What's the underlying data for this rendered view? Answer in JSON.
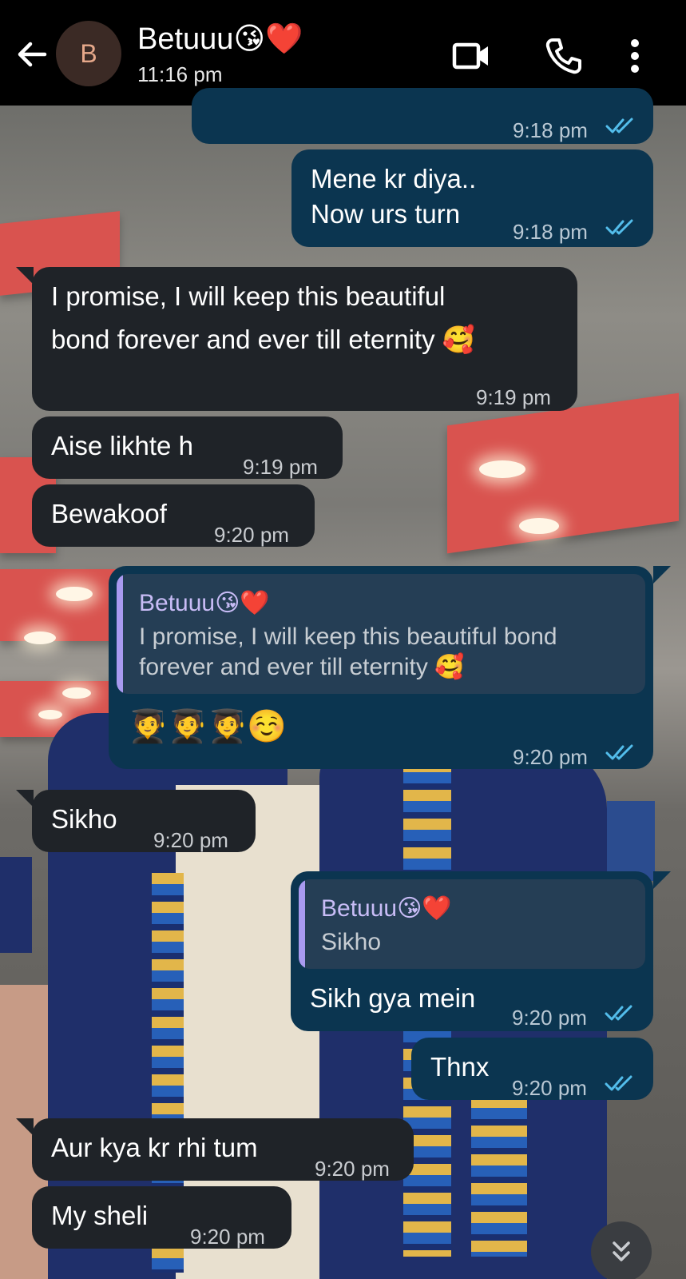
{
  "header": {
    "avatar_letter": "B",
    "contact_name": "Betuuu😘❤️",
    "last_seen": "11:16 pm",
    "icons": [
      "back-arrow-icon",
      "video-call-icon",
      "voice-call-icon",
      "more-vert-icon"
    ]
  },
  "messages": [
    {
      "direction": "out",
      "text": "",
      "time": "9:18 pm",
      "read": true
    },
    {
      "direction": "out",
      "lines": [
        "Mene kr diya..",
        "Now urs turn"
      ],
      "time": "9:18 pm",
      "read": true
    },
    {
      "direction": "in",
      "lines": [
        "I promise, I will keep this beautiful",
        "bond forever and ever till eternity 🥰"
      ],
      "time": "9:19 pm"
    },
    {
      "direction": "in",
      "text": "Aise likhte h",
      "time": "9:19 pm"
    },
    {
      "direction": "in",
      "text": "Bewakoof",
      "time": "9:20 pm"
    },
    {
      "direction": "out",
      "reply": {
        "name": "Betuuu😘❤️",
        "lines": [
          "I promise, I will keep this beautiful  bond",
          "forever and ever till eternity 🥰"
        ]
      },
      "text": "🧑‍🎓🧑‍🎓🧑‍🎓☺️",
      "time": "9:20 pm",
      "read": true
    },
    {
      "direction": "in",
      "text": "Sikho",
      "time": "9:20 pm"
    },
    {
      "direction": "out",
      "reply": {
        "name": "Betuuu😘❤️",
        "lines": [
          "Sikho"
        ]
      },
      "text": "Sikh gya mein",
      "time": "9:20 pm",
      "read": true
    },
    {
      "direction": "out",
      "text": "Thnx",
      "time": "9:20 pm",
      "read": true
    },
    {
      "direction": "in",
      "text": "Aur kya kr rhi tum",
      "time": "9:20 pm"
    },
    {
      "direction": "in",
      "text": "My sheli",
      "time": "9:20 pm"
    }
  ],
  "colors": {
    "header_bg": "#000000",
    "incoming_bubble": "#1f2328",
    "outgoing_bubble": "#0b3550",
    "reply_bar": "#a99af0",
    "read_ticks": "#53bdeb"
  }
}
